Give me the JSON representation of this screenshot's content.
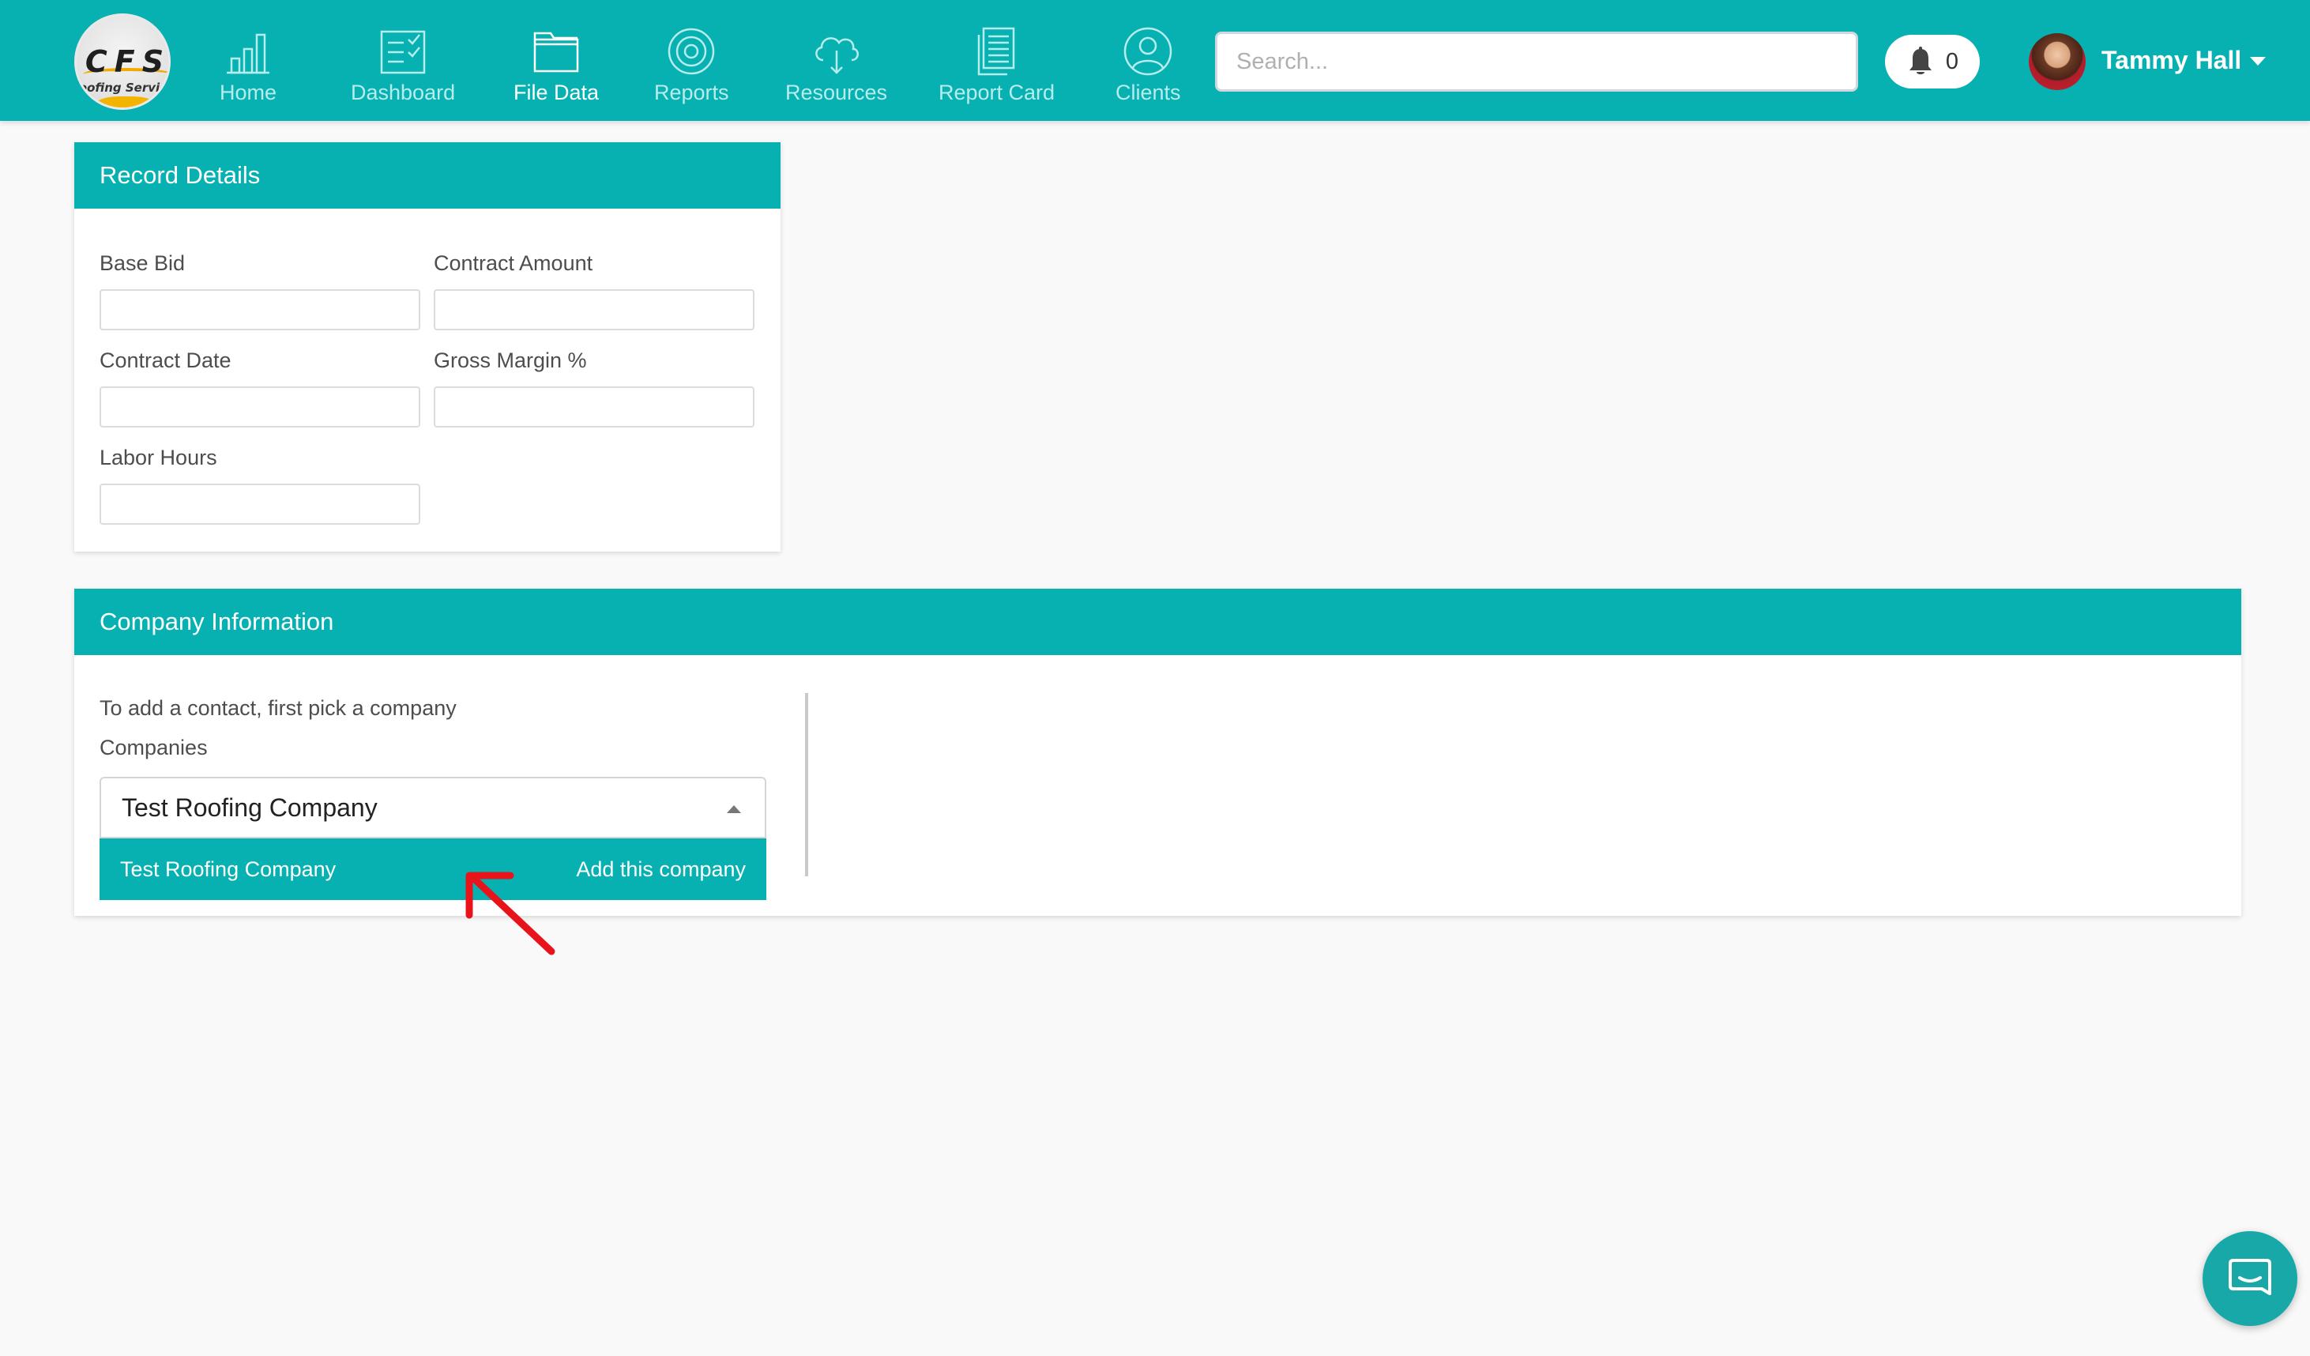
{
  "brand": {
    "logo_text": "CFS",
    "logo_subtext": "Roofing Services"
  },
  "nav": {
    "items": [
      {
        "label": "Home",
        "icon": "bar-chart-icon"
      },
      {
        "label": "Dashboard",
        "icon": "checklist-icon"
      },
      {
        "label": "File Data",
        "icon": "folder-icon",
        "active": true
      },
      {
        "label": "Reports",
        "icon": "target-icon"
      },
      {
        "label": "Resources",
        "icon": "cloud-download-icon"
      },
      {
        "label": "Report Card",
        "icon": "document-icon"
      },
      {
        "label": "Clients",
        "icon": "user-circle-icon"
      }
    ]
  },
  "search": {
    "placeholder": "Search...",
    "value": ""
  },
  "notifications": {
    "count": "0"
  },
  "user": {
    "name": "Tammy Hall"
  },
  "record_details": {
    "title": "Record Details",
    "fields": {
      "base_bid": {
        "label": "Base Bid",
        "value": ""
      },
      "contract_amount": {
        "label": "Contract Amount",
        "value": ""
      },
      "contract_date": {
        "label": "Contract Date",
        "value": ""
      },
      "gross_margin": {
        "label": "Gross Margin %",
        "value": ""
      },
      "labor_hours": {
        "label": "Labor Hours",
        "value": ""
      }
    }
  },
  "company_info": {
    "title": "Company Information",
    "hint": "To add a contact, first pick a company",
    "companies_label": "Companies",
    "selected_value": "Test Roofing Company",
    "dropdown": {
      "option_label": "Test Roofing Company",
      "option_action": "Add this company"
    }
  },
  "colors": {
    "brand_teal": "#07b1b1",
    "annotation_arrow": "#e8141c",
    "chat_bubble": "#19a8a8"
  }
}
